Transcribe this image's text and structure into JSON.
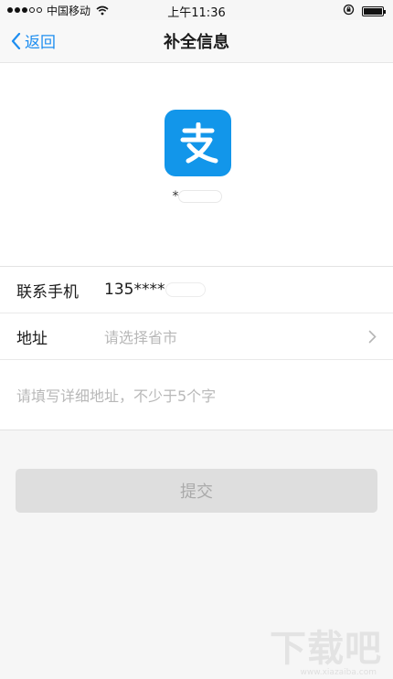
{
  "status_bar": {
    "carrier": "中国移动",
    "time": "上午11:36"
  },
  "nav": {
    "back_label": "返回",
    "title": "补全信息"
  },
  "profile": {
    "logo_glyph": "支",
    "masked_name": "*"
  },
  "form": {
    "phone_label": "联系手机",
    "phone_value": "135****",
    "address_label": "地址",
    "address_placeholder": "请选择省市",
    "detail_placeholder": "请填写详细地址，不少于5个字"
  },
  "submit_label": "提交",
  "watermark": {
    "main": "下载吧",
    "sub": "www.xiazaiba.com"
  },
  "colors": {
    "accent": "#1e8ef0",
    "logo_bg": "#1296ea",
    "button_bg": "#dedede"
  }
}
